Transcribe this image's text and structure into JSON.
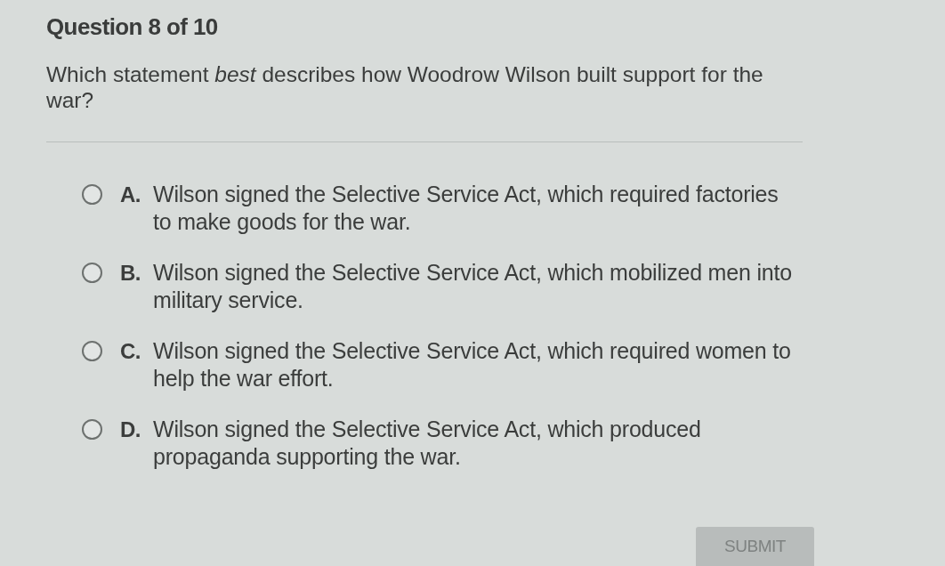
{
  "header": {
    "title": "Question 8 of 10"
  },
  "question": {
    "text": "Which statement *best* describes how Woodrow Wilson built support for the war?"
  },
  "options": [
    {
      "letter": "A.",
      "text": "Wilson signed the Selective Service Act, which required factories to make goods for the war.",
      "selected": false
    },
    {
      "letter": "B.",
      "text": "Wilson signed the Selective Service Act, which mobilized men into military service.",
      "selected": false
    },
    {
      "letter": "C.",
      "text": "Wilson signed the Selective Service Act, which required women to help the war effort.",
      "selected": false
    },
    {
      "letter": "D.",
      "text": "Wilson signed the Selective Service Act, which produced propaganda supporting the war.",
      "selected": false
    }
  ],
  "submit": {
    "label": "SUBMIT",
    "disabled": true
  }
}
